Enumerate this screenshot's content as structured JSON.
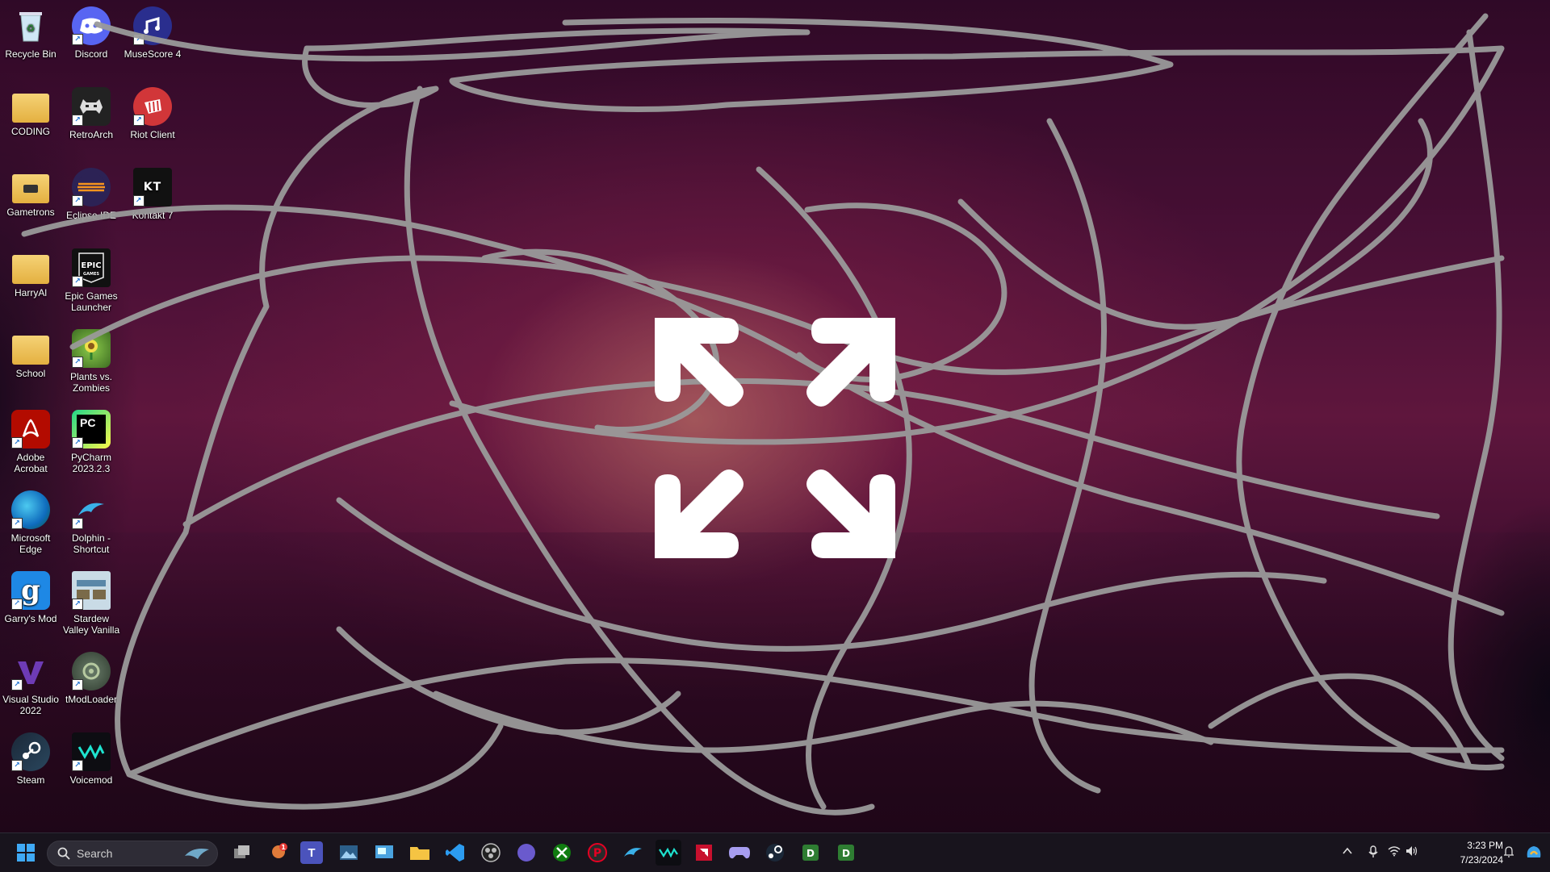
{
  "desktop": {
    "icons": [
      {
        "label": "Recycle Bin",
        "name": "recycle-bin"
      },
      {
        "label": "Discord",
        "name": "discord"
      },
      {
        "label": "MuseScore 4",
        "name": "musescore"
      },
      {
        "label": "CODING",
        "name": "coding-folder"
      },
      {
        "label": "RetroArch",
        "name": "retroarch"
      },
      {
        "label": "Riot Client",
        "name": "riot-client"
      },
      {
        "label": "Gametrons",
        "name": "gametrons-folder"
      },
      {
        "label": "Eclipse IDE",
        "name": "eclipse-ide"
      },
      {
        "label": "Kontakt 7",
        "name": "kontakt"
      },
      {
        "label": "HarryAl",
        "name": "harryal-folder"
      },
      {
        "label": "Epic Games Launcher",
        "name": "epic-games"
      },
      {
        "label": "School",
        "name": "school-folder"
      },
      {
        "label": "Plants vs. Zombies",
        "name": "plants-vs-zombies"
      },
      {
        "label": "Adobe Acrobat",
        "name": "adobe-acrobat"
      },
      {
        "label": "PyCharm 2023.2.3",
        "name": "pycharm"
      },
      {
        "label": "Microsoft Edge",
        "name": "microsoft-edge"
      },
      {
        "label": "Dolphin - Shortcut",
        "name": "dolphin"
      },
      {
        "label": "Garry's Mod",
        "name": "garrys-mod"
      },
      {
        "label": "Stardew Valley Vanilla",
        "name": "stardew-valley"
      },
      {
        "label": "Visual Studio 2022",
        "name": "visual-studio"
      },
      {
        "label": "tModLoader",
        "name": "tmodloader"
      },
      {
        "label": "Steam",
        "name": "steam"
      },
      {
        "label": "Voicemod",
        "name": "voicemod"
      }
    ]
  },
  "taskbar": {
    "search_placeholder": "Search",
    "time": "3:23 PM",
    "date": "7/23/2024",
    "notification_badge": "1"
  },
  "colors": {
    "scribble": "#9a9a9a",
    "glyph": "#ffffff",
    "taskbar": "#18161e"
  }
}
